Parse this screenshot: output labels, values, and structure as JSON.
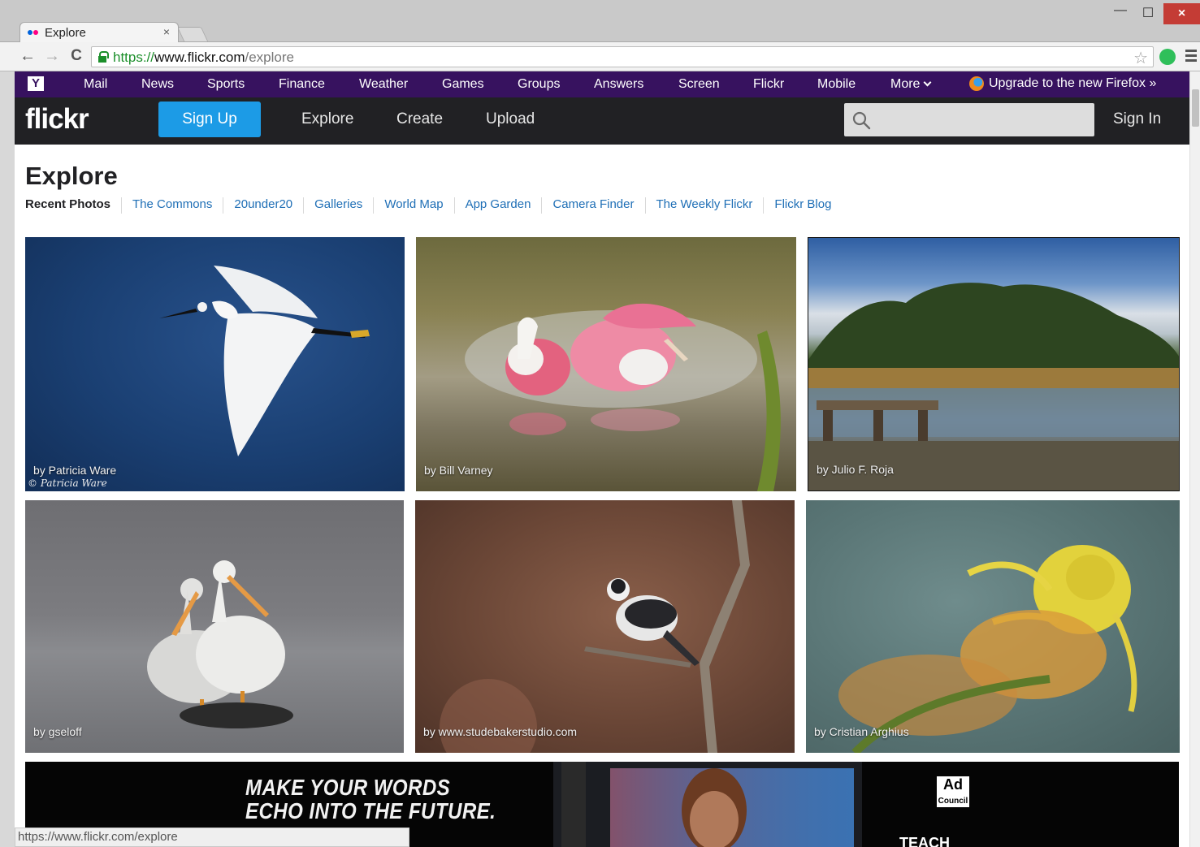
{
  "browser": {
    "tab_title": "Explore",
    "tab_close": "×",
    "window_controls": {
      "minimize": "—",
      "maximize": "☐",
      "close": "×"
    },
    "nav": {
      "back": "←",
      "forward": "→",
      "reload": "C"
    },
    "url_scheme": "https://",
    "url_host": "www.flickr.com",
    "url_path": "/explore",
    "status_url": "https://www.flickr.com/explore",
    "icons": [
      "back-arrow-icon",
      "forward-arrow-icon",
      "reload-icon",
      "lock-icon",
      "bookmark-star-icon",
      "extension-icon",
      "menu-icon"
    ]
  },
  "yahoo_bar": {
    "logo": "Y",
    "items": [
      "Mail",
      "News",
      "Sports",
      "Finance",
      "Weather",
      "Games",
      "Groups",
      "Answers",
      "Screen",
      "Flickr",
      "Mobile",
      "More"
    ],
    "upgrade": "Upgrade to the new Firefox »"
  },
  "header": {
    "logo": "flickr",
    "signup": "Sign Up",
    "links": [
      "Explore",
      "Create",
      "Upload"
    ],
    "signin": "Sign In",
    "search_placeholder": ""
  },
  "page": {
    "title": "Explore",
    "subnav": [
      "Recent Photos",
      "The Commons",
      "20under20",
      "Galleries",
      "World Map",
      "App Garden",
      "Camera Finder",
      "The Weekly Flickr",
      "Flickr Blog"
    ]
  },
  "photos": [
    {
      "credit": "by Patricia Ware",
      "watermark": "© Patricia Ware",
      "subject": "egret-in-flight"
    },
    {
      "credit": "by Bill Varney",
      "subject": "spoonbills-splashing"
    },
    {
      "credit": "by Julio F. Roja",
      "subject": "lake-landscape"
    },
    {
      "credit": "by gseloff",
      "subject": "pelicans"
    },
    {
      "credit": "by www.studebakerstudio.com",
      "subject": "warbler-on-branch"
    },
    {
      "credit": "by Cristian Arghius",
      "subject": "crab-spider-on-flower"
    }
  ],
  "ad": {
    "line1": "MAKE YOUR WORDS",
    "line2": "ECHO INTO THE FUTURE.",
    "logo": "Ad Council",
    "teach": "TEACH"
  },
  "colors": {
    "yahoo_purple": "#37125f",
    "flickr_header": "#212124",
    "signup_blue": "#1c9be6",
    "link_blue": "#1f6fb6",
    "flickr_pink": "#ff0084",
    "flickr_blue": "#0063dc"
  }
}
